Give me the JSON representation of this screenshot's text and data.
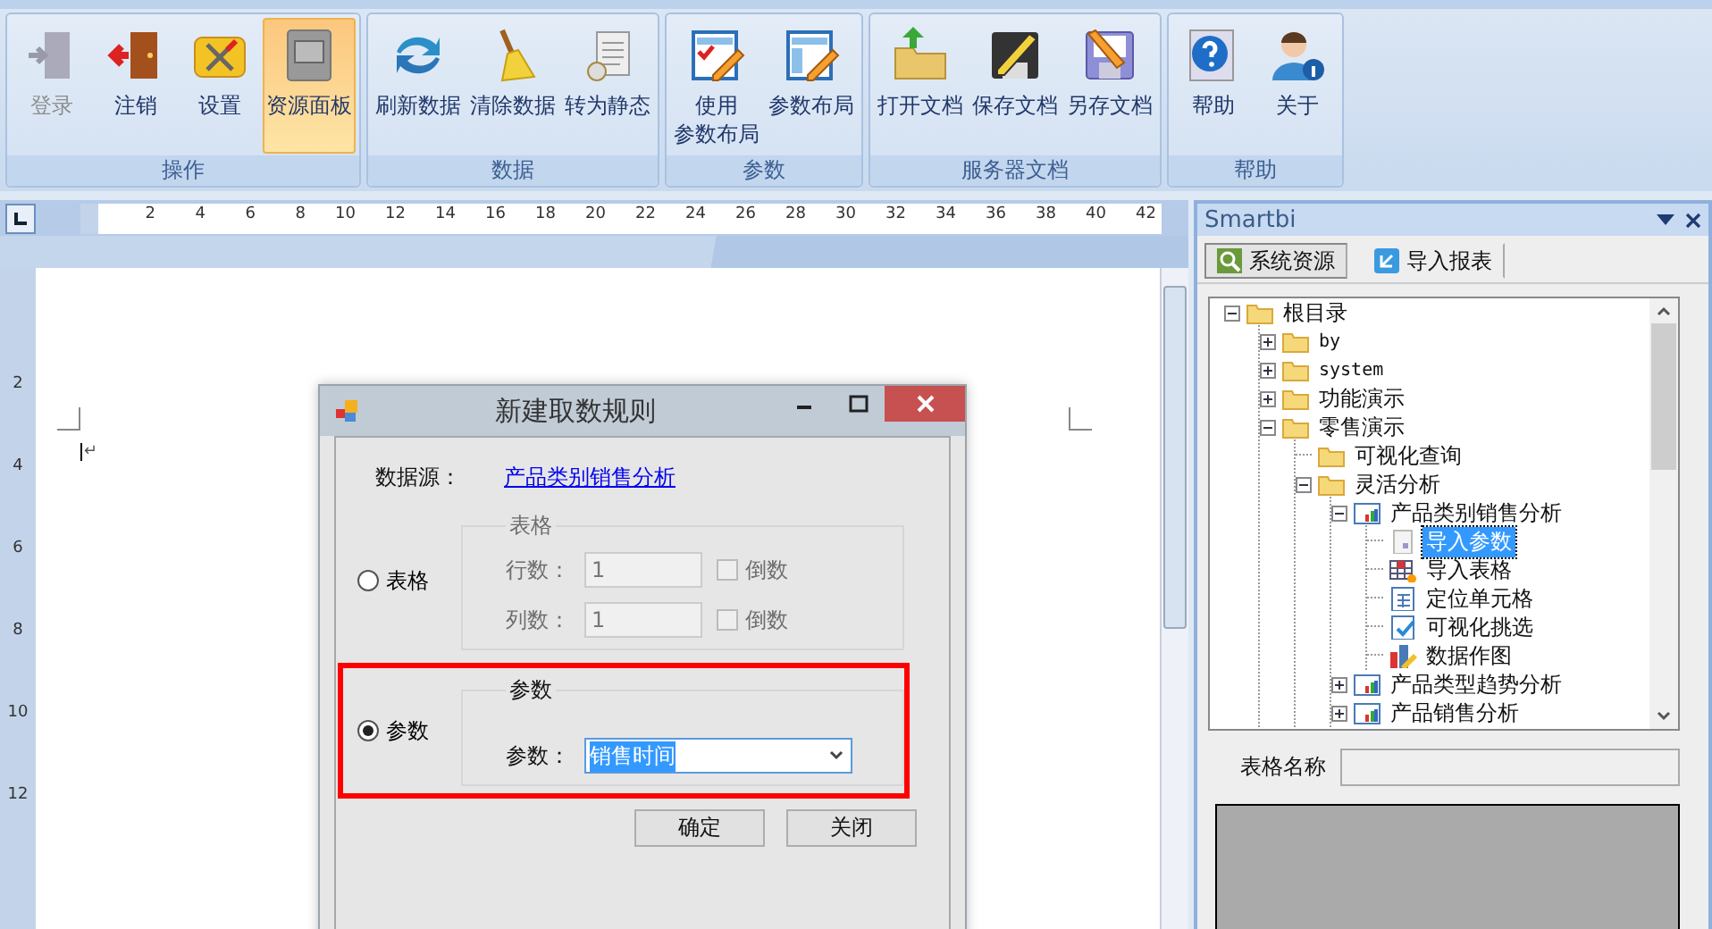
{
  "ribbon": {
    "groups": [
      {
        "caption": "操作",
        "buttons": [
          {
            "lines": [
              "登录"
            ],
            "disabled": true,
            "selected": false
          },
          {
            "lines": [
              "注销"
            ],
            "disabled": false,
            "selected": false
          },
          {
            "lines": [
              "设置"
            ],
            "disabled": false,
            "selected": false
          },
          {
            "lines": [
              "资源面板"
            ],
            "disabled": false,
            "selected": true
          }
        ]
      },
      {
        "caption": "数据",
        "buttons": [
          {
            "lines": [
              "刷新数据"
            ],
            "disabled": false,
            "selected": false
          },
          {
            "lines": [
              "清除数据"
            ],
            "disabled": false,
            "selected": false
          },
          {
            "lines": [
              "转为静态"
            ],
            "disabled": false,
            "selected": false
          }
        ]
      },
      {
        "caption": "参数",
        "buttons": [
          {
            "lines": [
              "使用",
              "参数布局"
            ],
            "disabled": false,
            "selected": false
          },
          {
            "lines": [
              "参数布局"
            ],
            "disabled": false,
            "selected": false
          }
        ]
      },
      {
        "caption": "服务器文档",
        "buttons": [
          {
            "lines": [
              "打开文档"
            ],
            "disabled": false,
            "selected": false
          },
          {
            "lines": [
              "保存文档"
            ],
            "disabled": false,
            "selected": false
          },
          {
            "lines": [
              "另存文档"
            ],
            "disabled": false,
            "selected": false
          }
        ]
      },
      {
        "caption": "帮助",
        "buttons": [
          {
            "lines": [
              "帮助"
            ],
            "disabled": false,
            "selected": false
          },
          {
            "lines": [
              "关于"
            ],
            "disabled": false,
            "selected": false
          }
        ]
      }
    ]
  },
  "ruler": {
    "marks": [
      "2",
      "4",
      "6",
      "8",
      "10",
      "12",
      "14",
      "16",
      "18",
      "20",
      "22",
      "24",
      "26",
      "28",
      "30",
      "32",
      "34",
      "36",
      "38",
      "40",
      "42"
    ]
  },
  "vertical_ruler": {
    "marks": [
      "2",
      "4",
      "6",
      "8",
      "10",
      "12"
    ]
  },
  "document": {
    "paragraph_mark": "↵"
  },
  "dialog": {
    "title": "新建取数规则",
    "datasource_label": "数据源：",
    "datasource_link": "产品类别销售分析",
    "options": [
      {
        "kind": "table",
        "label": "表格",
        "selected": false,
        "group_title": "表格",
        "rows": [
          {
            "label": "行数：",
            "value": "1",
            "checkbox_label": "倒数",
            "checked": false
          },
          {
            "label": "列数：",
            "value": "1",
            "checkbox_label": "倒数",
            "checked": false
          }
        ]
      },
      {
        "kind": "param",
        "label": "参数",
        "selected": true,
        "group_title": "参数",
        "field_label": "参数：",
        "value": "销售时间",
        "highlighted": true
      }
    ],
    "buttons": [
      "确定",
      "关闭"
    ]
  },
  "panel": {
    "title": "Smartbi",
    "tabs": [
      {
        "label": "系统资源",
        "selected": true
      },
      {
        "label": "导入报表",
        "selected": false
      }
    ],
    "tree": [
      {
        "label": "根目录",
        "kind": "folder",
        "selected": false,
        "expanded": true,
        "children": [
          {
            "label": "by",
            "kind": "folder",
            "selected": false,
            "expanded": false
          },
          {
            "label": "system",
            "kind": "folder",
            "selected": false,
            "expanded": false
          },
          {
            "label": "功能演示",
            "kind": "folder",
            "selected": false,
            "expanded": false
          },
          {
            "label": "零售演示",
            "kind": "folder",
            "selected": false,
            "expanded": true,
            "children": [
              {
                "label": "可视化查询",
                "kind": "folder",
                "selected": false
              },
              {
                "label": "灵活分析",
                "kind": "folder",
                "selected": false,
                "expanded": true,
                "children": [
                  {
                    "label": "产品类别销售分析",
                    "kind": "report",
                    "selected": false,
                    "expanded": true,
                    "children": [
                      {
                        "label": "导入参数",
                        "kind": "param",
                        "selected": true
                      },
                      {
                        "label": "导入表格",
                        "kind": "table",
                        "selected": false
                      },
                      {
                        "label": "定位单元格",
                        "kind": "cell",
                        "selected": false
                      },
                      {
                        "label": "可视化挑选",
                        "kind": "filter",
                        "selected": false
                      },
                      {
                        "label": "数据作图",
                        "kind": "chart",
                        "selected": false
                      }
                    ]
                  },
                  {
                    "label": "产品类型趋势分析",
                    "kind": "report",
                    "selected": false,
                    "expanded": false
                  },
                  {
                    "label": "产品销售分析",
                    "kind": "report",
                    "selected": false,
                    "expanded": false
                  }
                ]
              }
            ]
          }
        ]
      }
    ],
    "name_label": "表格名称"
  }
}
